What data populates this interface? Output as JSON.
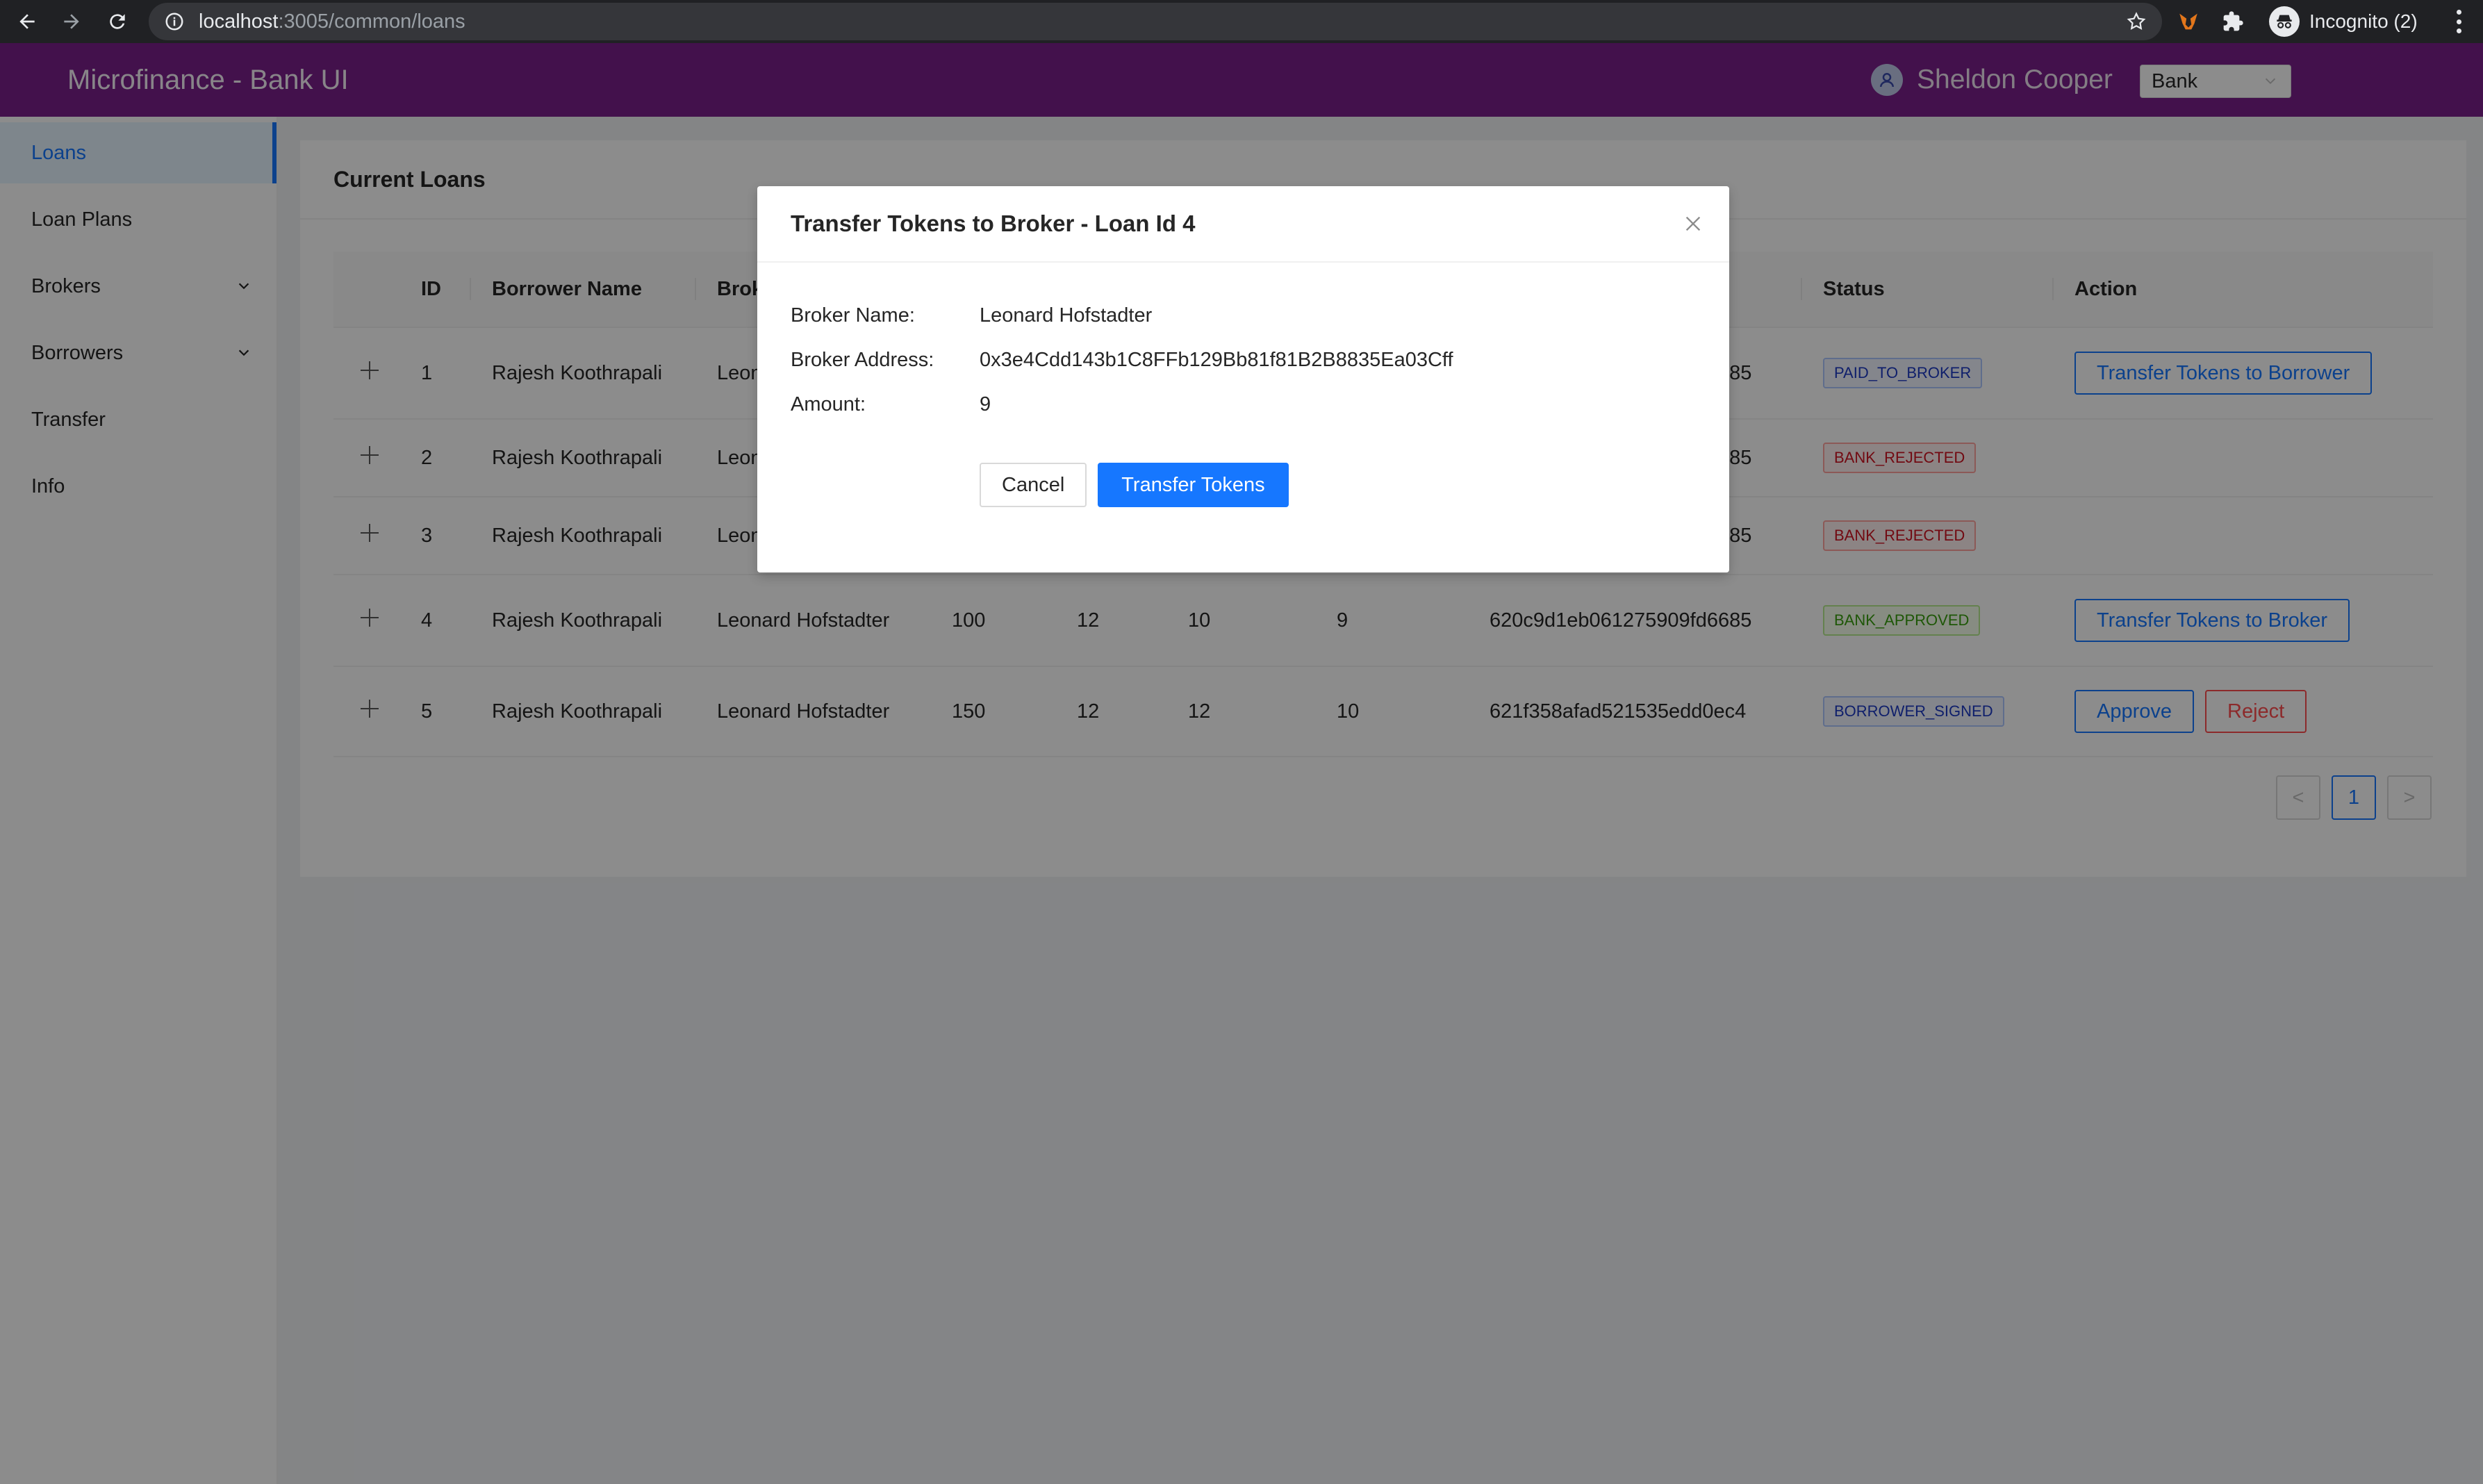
{
  "browser": {
    "url_host": "localhost",
    "url_path": ":3005/common/loans",
    "profile_label": "Incognito (2)"
  },
  "header": {
    "title": "Microfinance - Bank UI",
    "user_name": "Sheldon Cooper",
    "role_selected": "Bank"
  },
  "sidebar": {
    "items": [
      {
        "label": "Loans",
        "active": true
      },
      {
        "label": "Loan Plans"
      },
      {
        "label": "Brokers",
        "submenu": true
      },
      {
        "label": "Borrowers",
        "submenu": true
      },
      {
        "label": "Transfer"
      },
      {
        "label": "Info"
      }
    ]
  },
  "main": {
    "title": "Current Loans",
    "columns": [
      "",
      "ID",
      "Borrower Name",
      "Broker Name",
      "",
      "",
      "",
      "",
      "",
      "Status",
      "Action"
    ],
    "rows": [
      {
        "id": "1",
        "borrower": "Rajesh Koothrapali",
        "broker": "Leonard Hofstadter",
        "c5": "",
        "c6": "",
        "c7": "",
        "c8": "",
        "hash": "620c9d1eb061275909fd6685",
        "status": "PAID_TO_BROKER",
        "actions": [
          "Transfer Tokens to Borrower"
        ]
      },
      {
        "id": "2",
        "borrower": "Rajesh Koothrapali",
        "broker": "Leonard Hofstadter",
        "c5": "",
        "c6": "",
        "c7": "",
        "c8": "",
        "hash": "620c9d1eb061275909fd6685",
        "status": "BANK_REJECTED",
        "actions": []
      },
      {
        "id": "3",
        "borrower": "Rajesh Koothrapali",
        "broker": "Leonard Hofstadter",
        "c5": "",
        "c6": "",
        "c7": "",
        "c8": "",
        "hash": "620c9d1eb061275909fd6685",
        "status": "BANK_REJECTED",
        "actions": []
      },
      {
        "id": "4",
        "borrower": "Rajesh Koothrapali",
        "broker": "Leonard Hofstadter",
        "c5": "100",
        "c6": "12",
        "c7": "10",
        "c8": "9",
        "hash": "620c9d1eb061275909fd6685",
        "status": "BANK_APPROVED",
        "actions": [
          "Transfer Tokens to Broker"
        ]
      },
      {
        "id": "5",
        "borrower": "Rajesh Koothrapali",
        "broker": "Leonard Hofstadter",
        "c5": "150",
        "c6": "12",
        "c7": "12",
        "c8": "10",
        "hash": "621f358afad521535edd0ec4",
        "status": "BORROWER_SIGNED",
        "actions": [
          "Approve",
          "Reject"
        ]
      }
    ],
    "pagination": {
      "prev": "<",
      "current": "1",
      "next": ">"
    }
  },
  "modal": {
    "title": "Transfer Tokens to Broker - Loan Id 4",
    "broker_name_label": "Broker Name",
    "broker_name": "Leonard Hofstadter",
    "broker_address_label": "Broker Address",
    "broker_address": "0x3e4Cdd143b1C8FFb129Bb81f81B2B8835Ea03Cff",
    "amount_label": "Amount",
    "amount": "9",
    "cancel_label": "Cancel",
    "submit_label": "Transfer Tokens"
  },
  "colors": {
    "header_bg": "#7b1f8a",
    "primary": "#1677ff",
    "danger": "#ff4d4f"
  }
}
